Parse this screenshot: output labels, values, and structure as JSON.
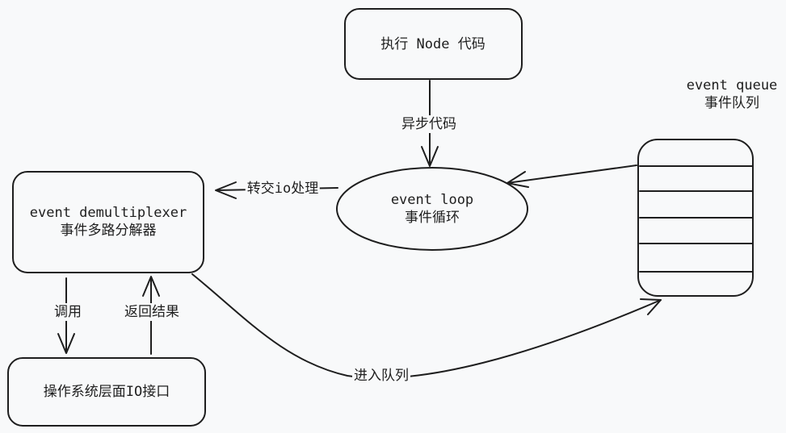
{
  "nodes": {
    "node_exec": {
      "label": "执行 Node 代码"
    },
    "event_loop": {
      "line1": "event loop",
      "line2": "事件循环"
    },
    "demux": {
      "line1": "event demultiplexer",
      "line2": "事件多路分解器"
    },
    "os_io": {
      "label": "操作系统层面IO接口"
    },
    "queue": {
      "line1": "event queue",
      "line2": "事件队列"
    }
  },
  "edges": {
    "async_code": "异步代码",
    "to_io": "转交io处理",
    "call": "调用",
    "return_result": "返回结果",
    "enter_queue": "进入队列"
  },
  "colors": {
    "stroke": "#1e1e1e",
    "background": "#f8f9fa"
  }
}
